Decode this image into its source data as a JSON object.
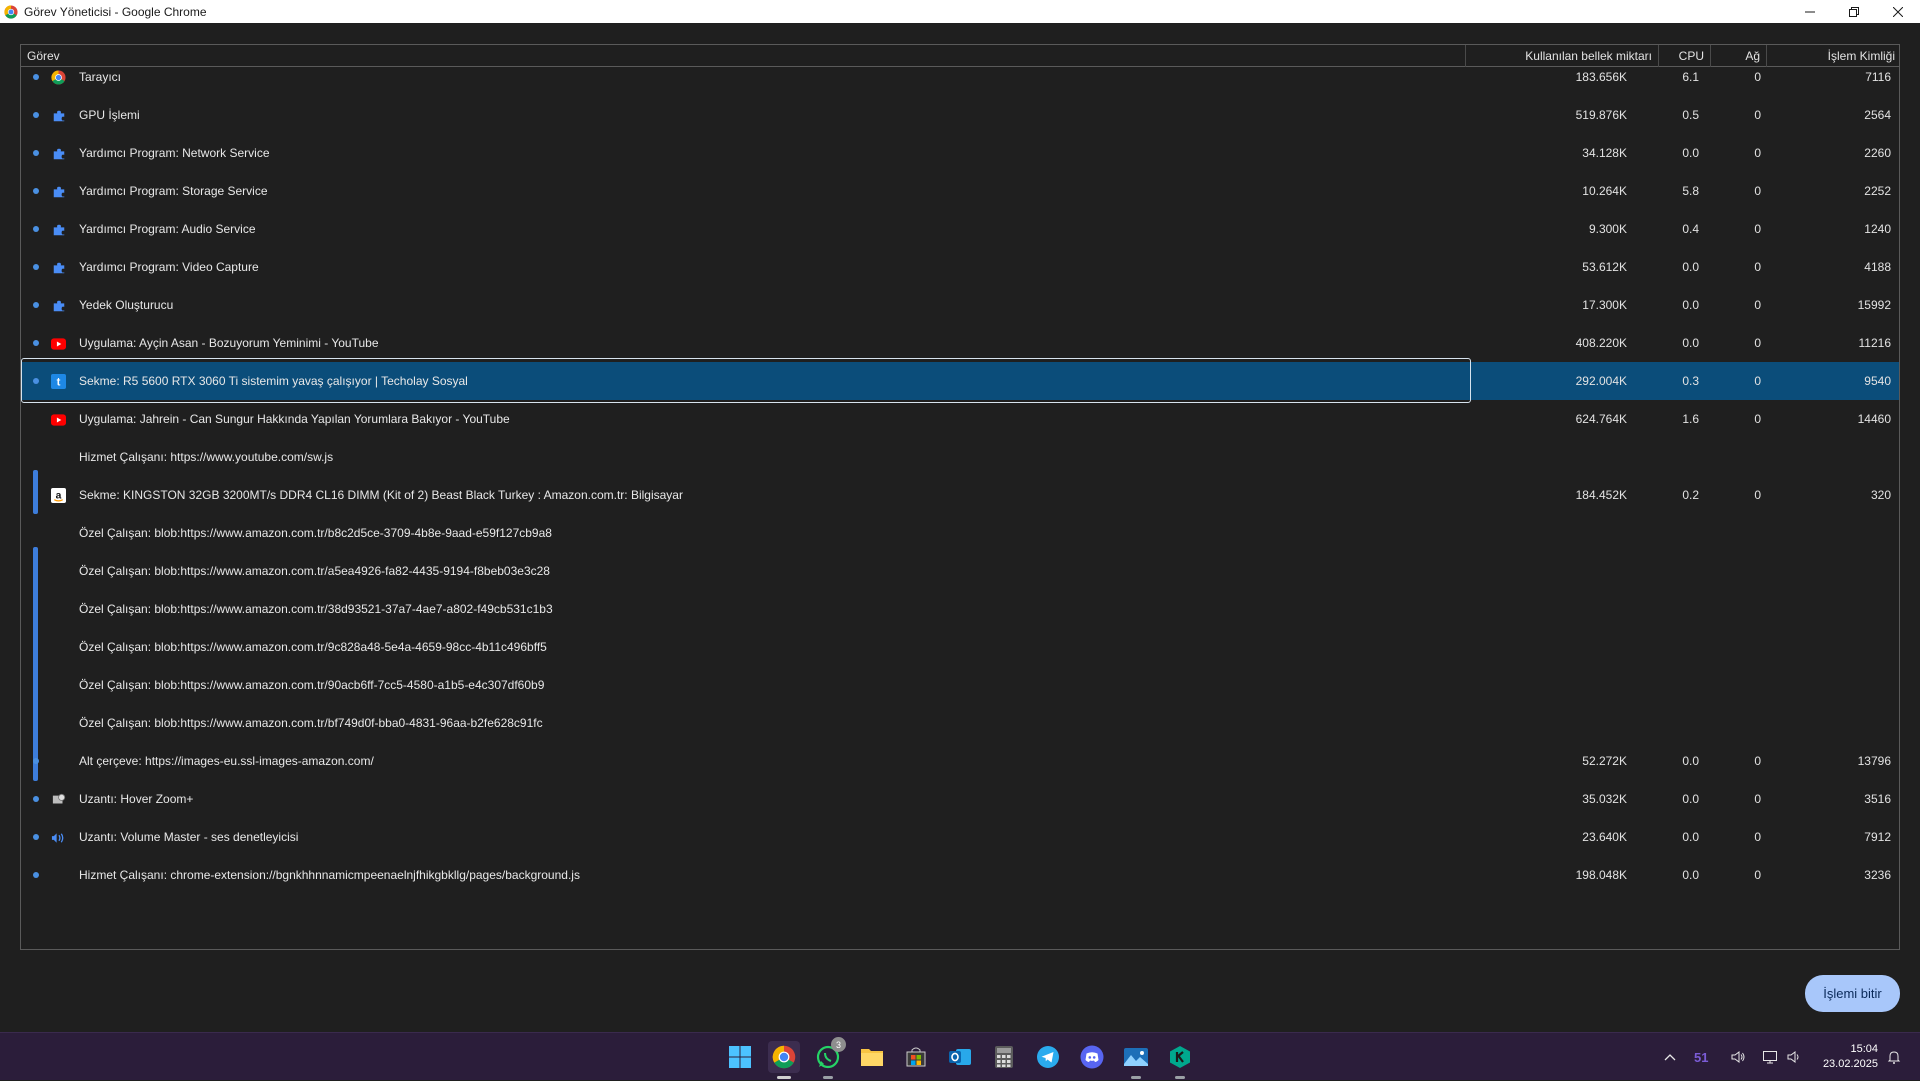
{
  "window": {
    "title": "Görev Yöneticisi - Google Chrome"
  },
  "columns": {
    "task": "Görev",
    "memory": "Kullanılan bellek miktarı",
    "cpu": "CPU",
    "network": "Ağ",
    "pid": "İşlem Kimliği"
  },
  "rows": [
    {
      "name": "Tarayıcı",
      "icon": "chrome-icon",
      "memory": "183.656K",
      "cpu": "6.1",
      "network": "0",
      "pid": "7116"
    },
    {
      "name": "GPU İşlemi",
      "icon": "puzzle-icon",
      "memory": "519.876K",
      "cpu": "0.5",
      "network": "0",
      "pid": "2564"
    },
    {
      "name": "Yardımcı Program: Network Service",
      "icon": "puzzle-icon",
      "memory": "34.128K",
      "cpu": "0.0",
      "network": "0",
      "pid": "2260"
    },
    {
      "name": "Yardımcı Program: Storage Service",
      "icon": "puzzle-icon",
      "memory": "10.264K",
      "cpu": "5.8",
      "network": "0",
      "pid": "2252"
    },
    {
      "name": "Yardımcı Program: Audio Service",
      "icon": "puzzle-icon",
      "memory": "9.300K",
      "cpu": "0.4",
      "network": "0",
      "pid": "1240"
    },
    {
      "name": "Yardımcı Program: Video Capture",
      "icon": "puzzle-icon",
      "memory": "53.612K",
      "cpu": "0.0",
      "network": "0",
      "pid": "4188"
    },
    {
      "name": "Yedek Oluşturucu",
      "icon": "puzzle-icon",
      "memory": "17.300K",
      "cpu": "0.0",
      "network": "0",
      "pid": "15992"
    },
    {
      "name": "Uygulama: Ayçin Asan - Bozuyorum Yeminimi - YouTube",
      "icon": "youtube-icon",
      "memory": "408.220K",
      "cpu": "0.0",
      "network": "0",
      "pid": "11216"
    },
    {
      "name": "Sekme: R5 5600 RTX 3060 Ti sistemim yavaş çalışıyor | Techolay Sosyal",
      "icon": "techolay-icon",
      "memory": "292.004K",
      "cpu": "0.3",
      "network": "0",
      "pid": "9540"
    },
    {
      "name": "Uygulama: Jahrein - Can Sungur Hakkında Yapılan Yorumlara Bakıyor - YouTube",
      "icon": "youtube-icon",
      "memory": "624.764K",
      "cpu": "1.6",
      "network": "0",
      "pid": "14460"
    },
    {
      "name": "Hizmet Çalışanı: https://www.youtube.com/sw.js",
      "icon": "",
      "memory": "",
      "cpu": "",
      "network": "",
      "pid": ""
    },
    {
      "name": "Sekme: KINGSTON 32GB 3200MT/s DDR4 CL16 DIMM (Kit of 2) Beast Black Turkey : Amazon.com.tr: Bilgisayar",
      "icon": "amazon-icon",
      "memory": "184.452K",
      "cpu": "0.2",
      "network": "0",
      "pid": "320"
    },
    {
      "name": "Özel Çalışan: blob:https://www.amazon.com.tr/b8c2d5ce-3709-4b8e-9aad-e59f127cb9a8",
      "icon": "",
      "memory": "",
      "cpu": "",
      "network": "",
      "pid": ""
    },
    {
      "name": "Özel Çalışan: blob:https://www.amazon.com.tr/a5ea4926-fa82-4435-9194-f8beb03e3c28",
      "icon": "",
      "memory": "",
      "cpu": "",
      "network": "",
      "pid": ""
    },
    {
      "name": "Özel Çalışan: blob:https://www.amazon.com.tr/38d93521-37a7-4ae7-a802-f49cb531c1b3",
      "icon": "",
      "memory": "",
      "cpu": "",
      "network": "",
      "pid": ""
    },
    {
      "name": "Özel Çalışan: blob:https://www.amazon.com.tr/9c828a48-5e4a-4659-98cc-4b11c496bff5",
      "icon": "",
      "memory": "",
      "cpu": "",
      "network": "",
      "pid": ""
    },
    {
      "name": "Özel Çalışan: blob:https://www.amazon.com.tr/90acb6ff-7cc5-4580-a1b5-e4c307df60b9",
      "icon": "",
      "memory": "",
      "cpu": "",
      "network": "",
      "pid": ""
    },
    {
      "name": "Özel Çalışan: blob:https://www.amazon.com.tr/bf749d0f-bba0-4831-96aa-b2fe628c91fc",
      "icon": "",
      "memory": "",
      "cpu": "",
      "network": "",
      "pid": ""
    },
    {
      "name": "Alt çerçeve: https://images-eu.ssl-images-amazon.com/",
      "icon": "",
      "memory": "52.272K",
      "cpu": "0.0",
      "network": "0",
      "pid": "13796"
    },
    {
      "name": "Uzantı: Hover Zoom+",
      "icon": "hoverzoom-icon",
      "memory": "35.032K",
      "cpu": "0.0",
      "network": "0",
      "pid": "3516"
    },
    {
      "name": "Uzantı: Volume Master - ses denetleyicisi",
      "icon": "volume-icon",
      "memory": "23.640K",
      "cpu": "0.0",
      "network": "0",
      "pid": "7912"
    },
    {
      "name": "Hizmet Çalışanı: chrome-extension://bgnkhhnnamicmpeenaelnjfhikgbkllg/pages/background.js",
      "icon": "",
      "memory": "198.048K",
      "cpu": "0.0",
      "network": "0",
      "pid": "3236"
    }
  ],
  "footer": {
    "end_process_label": "İşlemi bitir"
  },
  "taskbar": {
    "whatsapp_badge": "3",
    "tray_weather": "51",
    "clock_time": "15:04",
    "clock_date": "23.02.2025"
  },
  "colors": {
    "selection": "#0b4d7a",
    "accent": "#3d7ddb",
    "button": "#a8c7fa",
    "taskbar": "#2b1d3a"
  }
}
